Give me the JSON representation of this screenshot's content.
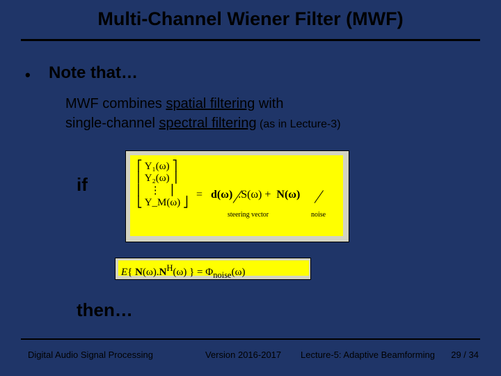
{
  "title": "Multi-Channel Wiener Filter (MWF)",
  "bullet": "•",
  "note": "Note that…",
  "body": {
    "line1_pre": "MWF combines ",
    "line1_u": "spatial filtering",
    "line1_post": " with",
    "line2_pre": "single-channel ",
    "line2_u": "spectral filtering",
    "line2_paren": " (as in Lecture-3)"
  },
  "if_label": "if",
  "eq1": {
    "y1": "Y₁(ω)",
    "y2": "Y₂(ω)",
    "dots": "⋮",
    "ym": "Y_M(ω)",
    "eq": "=",
    "d": "d(ω)",
    "s": ".S(ω) +",
    "n": "N(ω)",
    "sv_label": "steering vector",
    "noise_label": "noise"
  },
  "eq2": {
    "text": "E{ N(ω).Nᴴ(ω) } = Φ_noise(ω)"
  },
  "then_label": "then…",
  "footer": {
    "left": "Digital Audio Signal Processing",
    "mid": "Version 2016-2017",
    "right": "Lecture-5: Adaptive Beamforming",
    "page": "29 / 34"
  }
}
